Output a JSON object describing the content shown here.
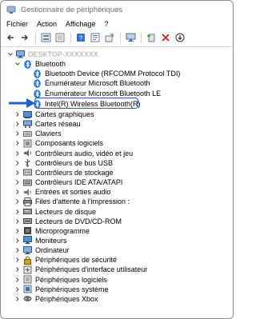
{
  "window": {
    "title": "Gestionnaire de périphériques"
  },
  "menu": [
    "Fichier",
    "Action",
    "Affichage",
    "?"
  ],
  "toolbar": {
    "icons": [
      "back-arrow-icon",
      "forward-arrow-icon",
      "show-hidden-icon",
      "properties-icon",
      "help-icon",
      "properties-sheet-icon",
      "update-driver-icon",
      "scan-hardware-icon",
      "add-driver-icon",
      "uninstall-icon",
      "download-icon"
    ]
  },
  "tree": {
    "computer_label": "DESKTOP-XXXXXXX",
    "bluetooth": {
      "label": "Bluetooth",
      "children": [
        "Bluetooth Device (RFCOMM Protocol TDI)",
        "Énumérateur Microsoft Bluetooth",
        "Énumérateur Microsoft Bluetooth LE",
        "Intel(R) Wireless Bluetooth(R)"
      ]
    },
    "categories": [
      "Cartes graphiques",
      "Cartes réseau",
      "Claviers",
      "Composants logiciels",
      "Contrôleurs audio, vidéo et jeu",
      "Contrôleurs de bus USB",
      "Contrôleurs de stockage",
      "Contrôleurs IDE ATA/ATAPI",
      "Entrées et sorties audio",
      "Files d'attente à l'impression :",
      "Lecteurs de disque",
      "Lecteurs de DVD/CD-ROM",
      "Microprogramme",
      "Moniteurs",
      "Ordinateur",
      "Périphériques de sécurité",
      "Périphériques d'interface utilisateur",
      "Périphériques logiciels",
      "Périphériques système",
      "Périphériques Xbox"
    ]
  },
  "colors": {
    "accent": "#1f5fd3",
    "bluetooth": "#1f6fd6"
  }
}
